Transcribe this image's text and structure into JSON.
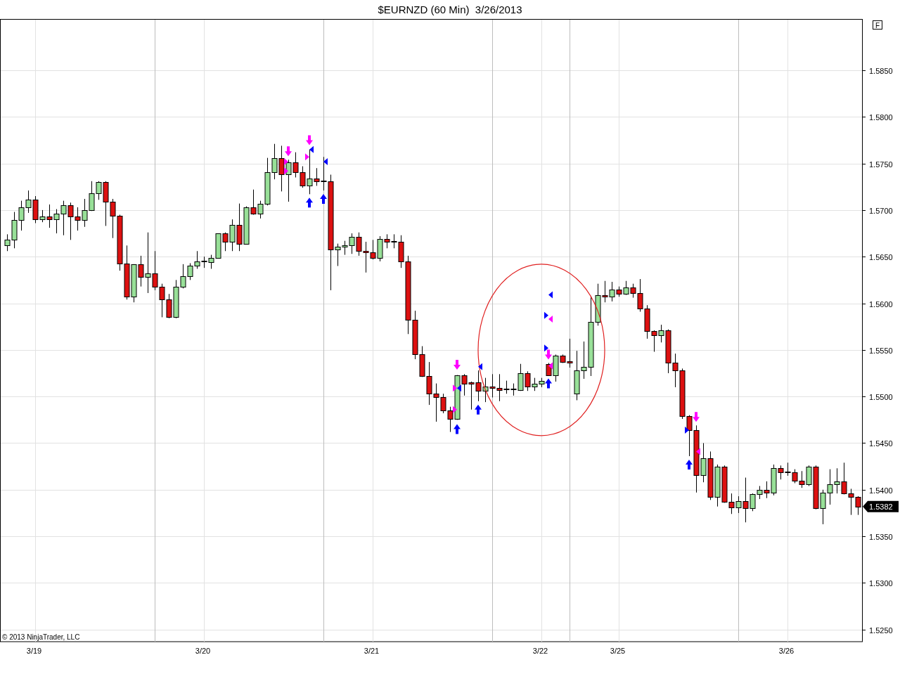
{
  "chart": {
    "panel_button": "F",
    "copyright": "© 2013 NinjaTrader, LLC",
    "last_price": "1.5382",
    "chart_data": {
      "type": "candlestick",
      "title": "$EURNZD (60 Min)  3/26/2013",
      "grid": true,
      "ylim": [
        1.5237,
        1.5905
      ],
      "categories": [
        null,
        null,
        null,
        null,
        "3/19",
        null,
        null,
        null,
        null,
        null,
        null,
        null,
        null,
        null,
        null,
        null,
        null,
        null,
        null,
        null,
        null,
        null,
        null,
        null,
        null,
        null,
        null,
        null,
        "3/20",
        null,
        null,
        null,
        null,
        null,
        null,
        null,
        null,
        null,
        null,
        null,
        null,
        null,
        null,
        null,
        null,
        null,
        null,
        null,
        null,
        null,
        null,
        null,
        "3/21",
        null,
        null,
        null,
        null,
        null,
        null,
        null,
        null,
        null,
        null,
        null,
        null,
        null,
        null,
        null,
        null,
        null,
        null,
        null,
        null,
        null,
        null,
        null,
        "3/22",
        null,
        null,
        null,
        null,
        null,
        null,
        null,
        null,
        null,
        null,
        "3/25",
        null,
        null,
        null,
        null,
        null,
        null,
        null,
        null,
        null,
        null,
        null,
        null,
        null,
        null,
        null,
        null,
        null,
        null,
        null,
        null,
        null,
        null,
        null,
        "3/26",
        null,
        null,
        null,
        null,
        null,
        null,
        null,
        null,
        null,
        null
      ],
      "yticks": [
        {
          "value": 1.585,
          "label": "1.5850"
        },
        {
          "value": 1.58,
          "label": "1.5800"
        },
        {
          "value": 1.575,
          "label": "1.5750"
        },
        {
          "value": 1.57,
          "label": "1.5700"
        },
        {
          "value": 1.565,
          "label": "1.5650"
        },
        {
          "value": 1.56,
          "label": "1.5600"
        },
        {
          "value": 1.555,
          "label": "1.5550"
        },
        {
          "value": 1.55,
          "label": "1.5500"
        },
        {
          "value": 1.545,
          "label": "1.5450"
        },
        {
          "value": 1.54,
          "label": "1.5400"
        },
        {
          "value": 1.535,
          "label": "1.5350"
        },
        {
          "value": 1.53,
          "label": "1.5300"
        },
        {
          "value": 1.525,
          "label": "1.5250"
        }
      ],
      "ohlc": [
        [
          1.5662,
          1.5674,
          1.5656,
          1.5668
        ],
        [
          1.5668,
          1.5698,
          1.5659,
          1.5689
        ],
        [
          1.5689,
          1.571,
          1.5678,
          1.5703
        ],
        [
          1.5703,
          1.5721,
          1.5697,
          1.5711
        ],
        [
          1.5711,
          1.5715,
          1.5686,
          1.569
        ],
        [
          1.569,
          1.57,
          1.5687,
          1.5693
        ],
        [
          1.5693,
          1.5706,
          1.5681,
          1.569
        ],
        [
          1.569,
          1.5701,
          1.5675,
          1.5696
        ],
        [
          1.5696,
          1.571,
          1.5673,
          1.5705
        ],
        [
          1.5705,
          1.5708,
          1.5668,
          1.5693
        ],
        [
          1.5693,
          1.5703,
          1.5678,
          1.5689
        ],
        [
          1.5689,
          1.5712,
          1.5682,
          1.57
        ],
        [
          1.57,
          1.5731,
          1.5699,
          1.5718
        ],
        [
          1.5718,
          1.5731,
          1.5711,
          1.573
        ],
        [
          1.573,
          1.5731,
          1.5683,
          1.5709
        ],
        [
          1.5709,
          1.5712,
          1.567,
          1.5694
        ],
        [
          1.5694,
          1.5695,
          1.5635,
          1.5643
        ],
        [
          1.5643,
          1.5662,
          1.5604,
          1.5607
        ],
        [
          1.5607,
          1.5642,
          1.5601,
          1.5642
        ],
        [
          1.5642,
          1.5651,
          1.5618,
          1.5628
        ],
        [
          1.5628,
          1.5676,
          1.5611,
          1.5632
        ],
        [
          1.5632,
          1.5656,
          1.5614,
          1.5618
        ],
        [
          1.5618,
          1.5621,
          1.5585,
          1.5604
        ],
        [
          1.5604,
          1.561,
          1.5584,
          1.5585
        ],
        [
          1.5585,
          1.5625,
          1.5584,
          1.5618
        ],
        [
          1.5618,
          1.5642,
          1.5616,
          1.5629
        ],
        [
          1.5629,
          1.5643,
          1.5625,
          1.564
        ],
        [
          1.564,
          1.5656,
          1.5637,
          1.5645
        ],
        [
          1.5644,
          1.565,
          1.5638,
          1.5645
        ],
        [
          1.5644,
          1.5652,
          1.5637,
          1.5649
        ],
        [
          1.5649,
          1.5675,
          1.5648,
          1.5675
        ],
        [
          1.5675,
          1.5676,
          1.5656,
          1.5666
        ],
        [
          1.5666,
          1.569,
          1.5656,
          1.5684
        ],
        [
          1.5684,
          1.5707,
          1.5656,
          1.5664
        ],
        [
          1.5664,
          1.5704,
          1.5663,
          1.5703
        ],
        [
          1.5703,
          1.5722,
          1.5695,
          1.5696
        ],
        [
          1.5696,
          1.571,
          1.5691,
          1.5707
        ],
        [
          1.5707,
          1.5756,
          1.5705,
          1.5741
        ],
        [
          1.5741,
          1.5771,
          1.5733,
          1.5756
        ],
        [
          1.5756,
          1.5769,
          1.572,
          1.5738
        ],
        [
          1.5738,
          1.5754,
          1.5709,
          1.5751
        ],
        [
          1.5751,
          1.5762,
          1.5735,
          1.5741
        ],
        [
          1.5741,
          1.5747,
          1.5724,
          1.5726
        ],
        [
          1.5726,
          1.5765,
          1.5717,
          1.5734
        ],
        [
          1.5734,
          1.5745,
          1.5726,
          1.5731
        ],
        [
          1.5731,
          1.5757,
          1.5721,
          1.573
        ],
        [
          1.5731,
          1.5738,
          1.5614,
          1.5658
        ],
        [
          1.5658,
          1.5664,
          1.564,
          1.5661
        ],
        [
          1.5661,
          1.5667,
          1.5652,
          1.5662
        ],
        [
          1.5662,
          1.5675,
          1.5653,
          1.5671
        ],
        [
          1.5671,
          1.5676,
          1.5651,
          1.5656
        ],
        [
          1.5656,
          1.5666,
          1.5633,
          1.5655
        ],
        [
          1.5655,
          1.5668,
          1.5647,
          1.5649
        ],
        [
          1.5649,
          1.5672,
          1.5645,
          1.5669
        ],
        [
          1.5669,
          1.5674,
          1.5659,
          1.5666
        ],
        [
          1.5666,
          1.5674,
          1.5659,
          1.5665
        ],
        [
          1.5666,
          1.5673,
          1.5638,
          1.5645
        ],
        [
          1.5645,
          1.5651,
          1.5567,
          1.5582
        ],
        [
          1.5582,
          1.5592,
          1.554,
          1.5545
        ],
        [
          1.5545,
          1.5554,
          1.5521,
          1.5522
        ],
        [
          1.5522,
          1.5537,
          1.5491,
          1.5503
        ],
        [
          1.5503,
          1.5514,
          1.5473,
          1.5499
        ],
        [
          1.5499,
          1.5503,
          1.5482,
          1.5485
        ],
        [
          1.5485,
          1.5489,
          1.5462,
          1.5476
        ],
        [
          1.5476,
          1.5523,
          1.5475,
          1.5523
        ],
        [
          1.5523,
          1.5524,
          1.5501,
          1.5514
        ],
        [
          1.5515,
          1.5516,
          1.5486,
          1.5514
        ],
        [
          1.5515,
          1.5528,
          1.5495,
          1.5506
        ],
        [
          1.5506,
          1.552,
          1.5494,
          1.5511
        ],
        [
          1.5511,
          1.5524,
          1.5499,
          1.5509
        ],
        [
          1.5509,
          1.5524,
          1.5495,
          1.5507
        ],
        [
          1.5508,
          1.5517,
          1.5503,
          1.5507
        ],
        [
          1.5508,
          1.5514,
          1.5501,
          1.5507
        ],
        [
          1.5507,
          1.5535,
          1.5506,
          1.5525
        ],
        [
          1.5525,
          1.5527,
          1.5506,
          1.5511
        ],
        [
          1.5511,
          1.552,
          1.5506,
          1.5514
        ],
        [
          1.5514,
          1.552,
          1.551,
          1.5517
        ],
        [
          1.5535,
          1.5536,
          1.5522,
          1.5523
        ],
        [
          1.5523,
          1.5545,
          1.5516,
          1.5544
        ],
        [
          1.5544,
          1.5545,
          1.5536,
          1.5537
        ],
        [
          1.5538,
          1.5562,
          1.5531,
          1.5536
        ],
        [
          1.5503,
          1.5549,
          1.5496,
          1.5528
        ],
        [
          1.5528,
          1.5559,
          1.5519,
          1.5532
        ],
        [
          1.5532,
          1.5608,
          1.5522,
          1.558
        ],
        [
          1.558,
          1.5621,
          1.5576,
          1.5609
        ],
        [
          1.5609,
          1.5624,
          1.5601,
          1.5607
        ],
        [
          1.5607,
          1.5623,
          1.5602,
          1.5615
        ],
        [
          1.5615,
          1.5618,
          1.5607,
          1.561
        ],
        [
          1.561,
          1.5624,
          1.5609,
          1.5617
        ],
        [
          1.5617,
          1.5621,
          1.5606,
          1.5611
        ],
        [
          1.5611,
          1.5626,
          1.5591,
          1.5594
        ],
        [
          1.5594,
          1.5598,
          1.5562,
          1.557
        ],
        [
          1.557,
          1.5571,
          1.5548,
          1.5566
        ],
        [
          1.5566,
          1.5577,
          1.5558,
          1.5571
        ],
        [
          1.5571,
          1.5572,
          1.5525,
          1.5536
        ],
        [
          1.5536,
          1.5546,
          1.551,
          1.5528
        ],
        [
          1.5528,
          1.553,
          1.5476,
          1.5479
        ],
        [
          1.5479,
          1.548,
          1.5436,
          1.5464
        ],
        [
          1.5464,
          1.5469,
          1.5397,
          1.5416
        ],
        [
          1.5416,
          1.545,
          1.5408,
          1.5434
        ],
        [
          1.5434,
          1.5441,
          1.5389,
          1.5392
        ],
        [
          1.5392,
          1.5427,
          1.5382,
          1.5425
        ],
        [
          1.5425,
          1.5426,
          1.5386,
          1.5387
        ],
        [
          1.5387,
          1.5396,
          1.5374,
          1.5381
        ],
        [
          1.5381,
          1.5393,
          1.5375,
          1.5388
        ],
        [
          1.5388,
          1.5413,
          1.5365,
          1.538
        ],
        [
          1.538,
          1.5396,
          1.5377,
          1.5395
        ],
        [
          1.5395,
          1.5404,
          1.539,
          1.54
        ],
        [
          1.54,
          1.5409,
          1.5391,
          1.5397
        ],
        [
          1.5397,
          1.5427,
          1.5394,
          1.5423
        ],
        [
          1.5423,
          1.5426,
          1.5411,
          1.5419
        ],
        [
          1.5419,
          1.5429,
          1.5415,
          1.5418
        ],
        [
          1.5419,
          1.5422,
          1.5407,
          1.541
        ],
        [
          1.541,
          1.542,
          1.5402,
          1.5406
        ],
        [
          1.5406,
          1.5426,
          1.5404,
          1.5425
        ],
        [
          1.5425,
          1.5426,
          1.5379,
          1.538
        ],
        [
          1.538,
          1.54,
          1.5363,
          1.5397
        ],
        [
          1.5397,
          1.5422,
          1.5384,
          1.5406
        ],
        [
          1.5406,
          1.5423,
          1.5396,
          1.5409
        ],
        [
          1.5409,
          1.5429,
          1.5395,
          1.5396
        ],
        [
          1.5396,
          1.5401,
          1.5373,
          1.5392
        ],
        [
          1.5392,
          1.5393,
          1.5373,
          1.5382
        ]
      ]
    }
  }
}
